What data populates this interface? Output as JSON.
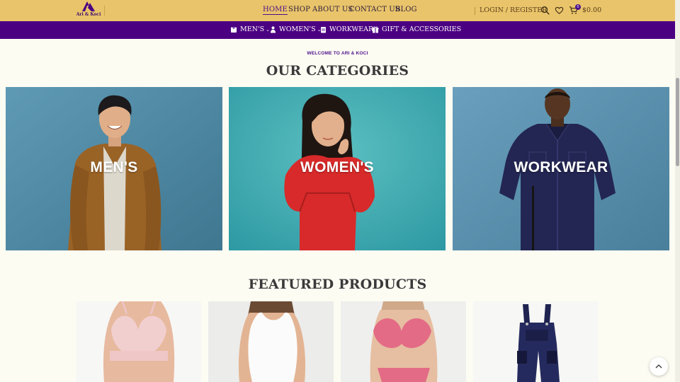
{
  "brand": {
    "name": "Ari & Koci",
    "color": "#4b0082"
  },
  "main_nav": [
    {
      "label": "HOME",
      "active": true
    },
    {
      "label": "SHOP",
      "active": false
    },
    {
      "label": "ABOUT US",
      "active": false
    },
    {
      "label": "CONTACT US",
      "active": false
    },
    {
      "label": "BLOG",
      "active": false
    }
  ],
  "header_actions": {
    "login_label": "LOGIN / REGISTER",
    "cart_count": "0",
    "cart_total": "$0.00",
    "icons": [
      "search-icon",
      "heart-icon",
      "cart-icon"
    ]
  },
  "category_nav": [
    {
      "label": "MEN'S",
      "icon": "shirt-icon",
      "has_dropdown": true
    },
    {
      "label": "WOMEN'S",
      "icon": "person-icon",
      "has_dropdown": true
    },
    {
      "label": "WORKWEAR",
      "icon": "uniform-icon",
      "has_dropdown": false
    },
    {
      "label": "GIFT & ACCESSORIES",
      "icon": "gift-icon",
      "has_dropdown": false
    }
  ],
  "categories_section": {
    "eyebrow": "WELCOME TO ARI & KOCI",
    "title": "OUR CATEGORIES",
    "cards": [
      {
        "label": "MEN'S"
      },
      {
        "label": "WOMEN'S"
      },
      {
        "label": "WORKWEAR"
      }
    ]
  },
  "featured_section": {
    "title": "FEATURED PRODUCTS",
    "products": [
      {
        "image": "pink-bra-photo"
      },
      {
        "image": "white-tank-top-photo"
      },
      {
        "image": "pink-lace-lingerie-photo"
      },
      {
        "image": "navy-work-overalls-photo"
      }
    ]
  },
  "colors": {
    "header_bg": "#e9c46a",
    "category_bar_bg": "#4b0082",
    "page_bg": "#fdfcf3"
  }
}
